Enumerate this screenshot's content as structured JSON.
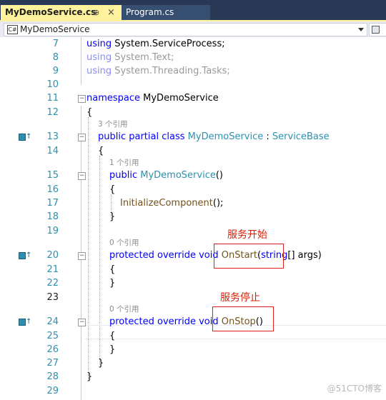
{
  "tabs": [
    {
      "label": "MyDemoService.cs",
      "pin": "⊕",
      "close": "×"
    },
    {
      "label": "Program.cs"
    }
  ],
  "navbar": {
    "class_label": "MyDemoService"
  },
  "lines": {
    "l7": {
      "num": "7",
      "kw": "using",
      "rest": " System.ServiceProcess;"
    },
    "l8": {
      "num": "8",
      "kw": "using",
      "rest": " System.Text;"
    },
    "l9": {
      "num": "9",
      "kw": "using",
      "rest": " System.Threading.Tasks;"
    },
    "l10": {
      "num": "10"
    },
    "l11": {
      "num": "11",
      "kw": "namespace",
      "rest": " MyDemoService"
    },
    "l12": {
      "num": "12",
      "text": "{"
    },
    "lens1": "3 个引用",
    "l13": {
      "num": "13",
      "kw": "public partial class",
      "type1": "MyDemoService",
      "sep": " : ",
      "type2": "ServiceBase"
    },
    "l14": {
      "num": "14",
      "text": "{"
    },
    "lens2": "1 个引用",
    "l15": {
      "num": "15",
      "kw": "public",
      "type1": "MyDemoService",
      "rest": "()"
    },
    "l16": {
      "num": "16",
      "text": "{"
    },
    "l17": {
      "num": "17",
      "fn": "InitializeComponent",
      "rest": "();"
    },
    "l18": {
      "num": "18",
      "text": "}"
    },
    "l19": {
      "num": "19"
    },
    "lens3": "0 个引用",
    "l20": {
      "num": "20",
      "kw": "protected override void",
      "fn": "OnStart",
      "p1": "(",
      "kw2": "string",
      "rest": "[] args)"
    },
    "l21": {
      "num": "21",
      "text": "{"
    },
    "l22": {
      "num": "22",
      "text": "}"
    },
    "l23": {
      "num": "23"
    },
    "lens4": "0 个引用",
    "l24": {
      "num": "24",
      "kw": "protected override void",
      "fn": "OnStop",
      "rest": "()"
    },
    "l25": {
      "num": "25",
      "text": "{"
    },
    "l26": {
      "num": "26",
      "text": "}"
    },
    "l27": {
      "num": "27",
      "text": "}"
    },
    "l28": {
      "num": "28",
      "text": "}"
    },
    "l29": {
      "num": "29"
    }
  },
  "annotations": {
    "start": "服务开始",
    "stop": "服务停止"
  },
  "watermark": "@51CTO博客",
  "colors": {
    "keyword": "#0000ff",
    "type": "#2b91af",
    "method": "#74531f",
    "linenumber": "#2b91af",
    "annotation": "#d81e06",
    "tab_active": "#fff29d"
  }
}
